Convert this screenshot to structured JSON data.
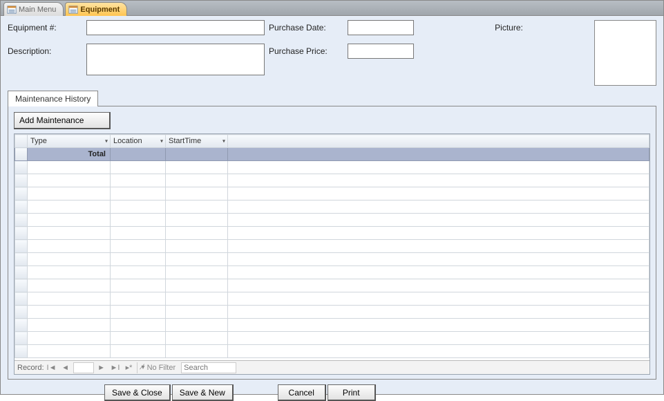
{
  "tabs": {
    "main_menu": "Main Menu",
    "equipment": "Equipment"
  },
  "fields": {
    "equipment_no_label": "Equipment #:",
    "equipment_no_value": "",
    "description_label": "Description:",
    "description_value": "",
    "purchase_date_label": "Purchase Date:",
    "purchase_date_value": "",
    "purchase_price_label": "Purchase Price:",
    "purchase_price_value": "",
    "picture_label": "Picture:"
  },
  "subform": {
    "tab_label": "Maintenance History",
    "add_button": "Add Maintenance",
    "columns": {
      "type": "Type",
      "location": "Location",
      "starttime": "StartTime"
    },
    "total_label": "Total"
  },
  "recordnav": {
    "label": "Record:",
    "position": "",
    "filter": "No Filter",
    "search_placeholder": "Search"
  },
  "buttons": {
    "save_close": "Save & Close",
    "save_new": "Save & New",
    "cancel": "Cancel",
    "print": "Print"
  }
}
